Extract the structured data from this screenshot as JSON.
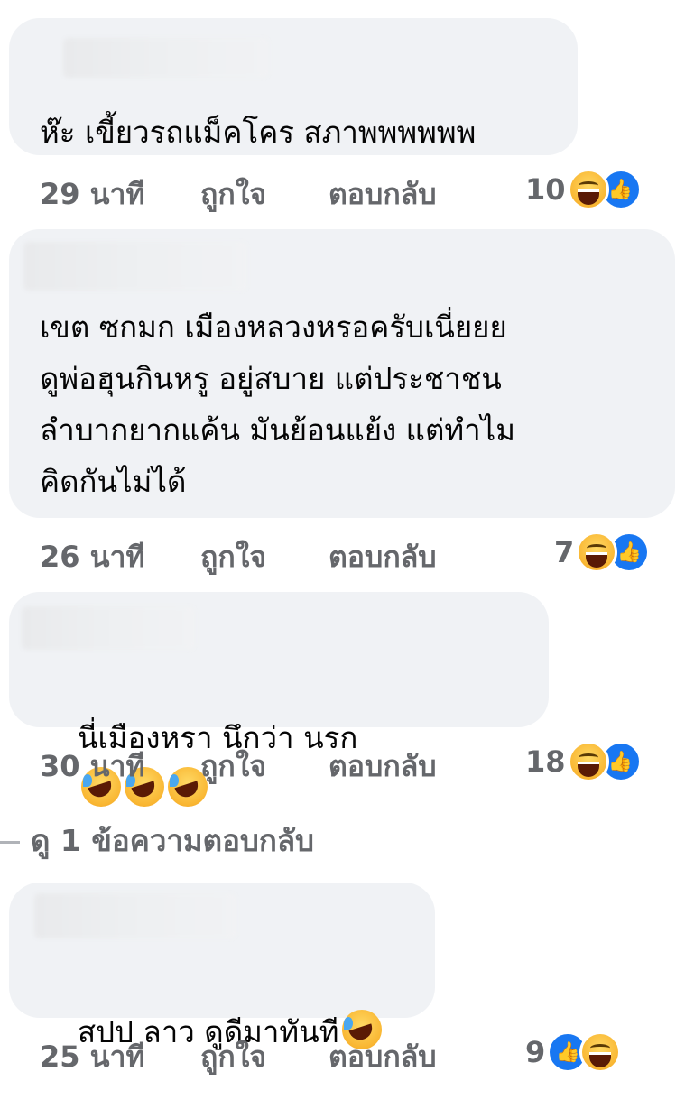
{
  "comments": [
    {
      "text": "ห๊ะ เขี้ยวรถแม็คโคร สภาพพพพพพ",
      "time": "29 นาที",
      "like": "ถูกใจ",
      "reply": "ตอบกลับ",
      "reaction_count": "10",
      "reactions": [
        "haha",
        "like"
      ]
    },
    {
      "text": "เขต ซกมก เมืองหลวงหรอครับเนี่ยยย\nดูพ่อฮุนกินหรู อยู่สบาย แต่ประชาชน\nลำบากยากแค้น มันย้อนแย้ง แต่ทำไม\nคิดกันไม่ได้",
      "time": "26 นาที",
      "like": "ถูกใจ",
      "reply": "ตอบกลับ",
      "reaction_count": "7",
      "reactions": [
        "haha",
        "like"
      ]
    },
    {
      "text": "นี่เมืองหรา นึกว่า นรก",
      "emoji_count": 3,
      "time": "30 นาที",
      "like": "ถูกใจ",
      "reply": "ตอบกลับ",
      "reaction_count": "18",
      "reactions": [
        "haha",
        "like"
      ]
    },
    {
      "text": "สปป ลาว ดูดีมาทันที",
      "emoji_count": 1,
      "time": "25 นาที",
      "like": "ถูกใจ",
      "reply": "ตอบกลับ",
      "reaction_count": "9",
      "reactions": [
        "like",
        "haha"
      ]
    }
  ],
  "view_replies": "ดู 1 ข้อความตอบกลับ",
  "colors": {
    "bubble": "#f0f2f5",
    "meta_text": "#65676b",
    "like_blue": "#1877f2",
    "haha_yellow": "#f9b632"
  }
}
